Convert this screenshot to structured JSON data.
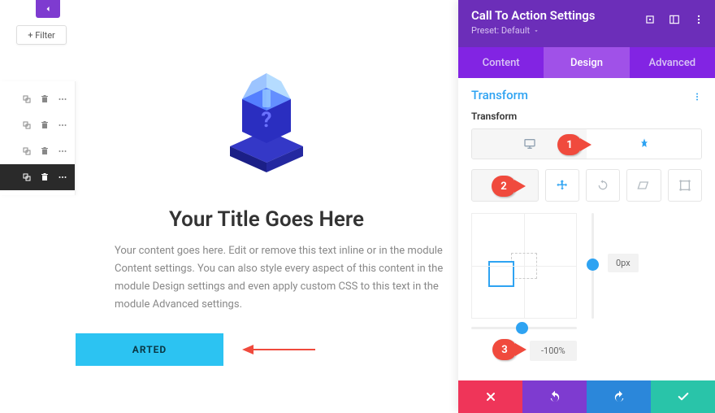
{
  "leftbar": {
    "filter_label": "+ Filter"
  },
  "module": {
    "title": "Your Title Goes Here",
    "body": "Your content goes here. Edit or remove this text inline or in the module Content settings. You can also style every aspect of this content in the module Design settings and even apply custom CSS to this text in the module Advanced settings.",
    "button_label": "ARTED"
  },
  "panel": {
    "title": "Call To Action Settings",
    "preset": "Preset: Default",
    "tabs": [
      "Content",
      "Design",
      "Advanced"
    ],
    "active_tab": 1,
    "section_title": "Transform",
    "section_label": "Transform",
    "origin": {
      "x_label": "-100%",
      "y_label": "0px"
    }
  },
  "callouts": {
    "one": "1",
    "two": "2",
    "three": "3"
  }
}
